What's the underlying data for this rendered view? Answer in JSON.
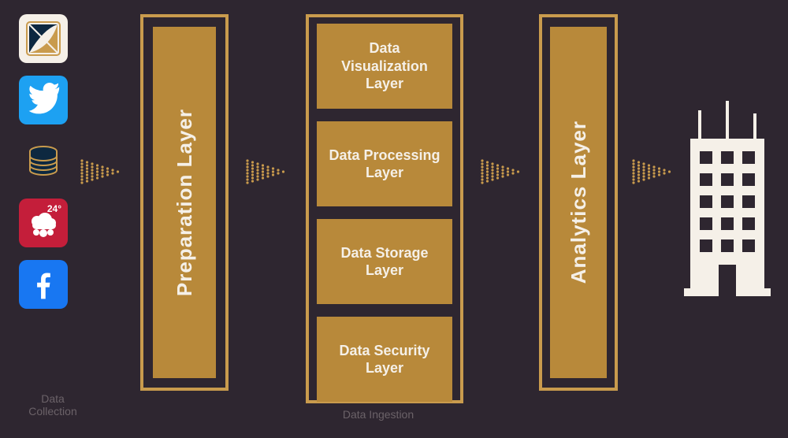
{
  "sources": {
    "caption": "Data Collection",
    "items": [
      {
        "name": "custom-logo-icon"
      },
      {
        "name": "twitter-icon"
      },
      {
        "name": "database-icon"
      },
      {
        "name": "weather-icon",
        "temp": "24°"
      },
      {
        "name": "facebook-icon"
      }
    ]
  },
  "preparation": {
    "label": "Preparation Layer"
  },
  "ingestion": {
    "caption": "Data Ingestion",
    "layers": [
      "Data Visualization Layer",
      "Data Processing Layer",
      "Data Storage Layer",
      "Data Security Layer"
    ]
  },
  "analytics": {
    "label": "Analytics Layer"
  }
}
